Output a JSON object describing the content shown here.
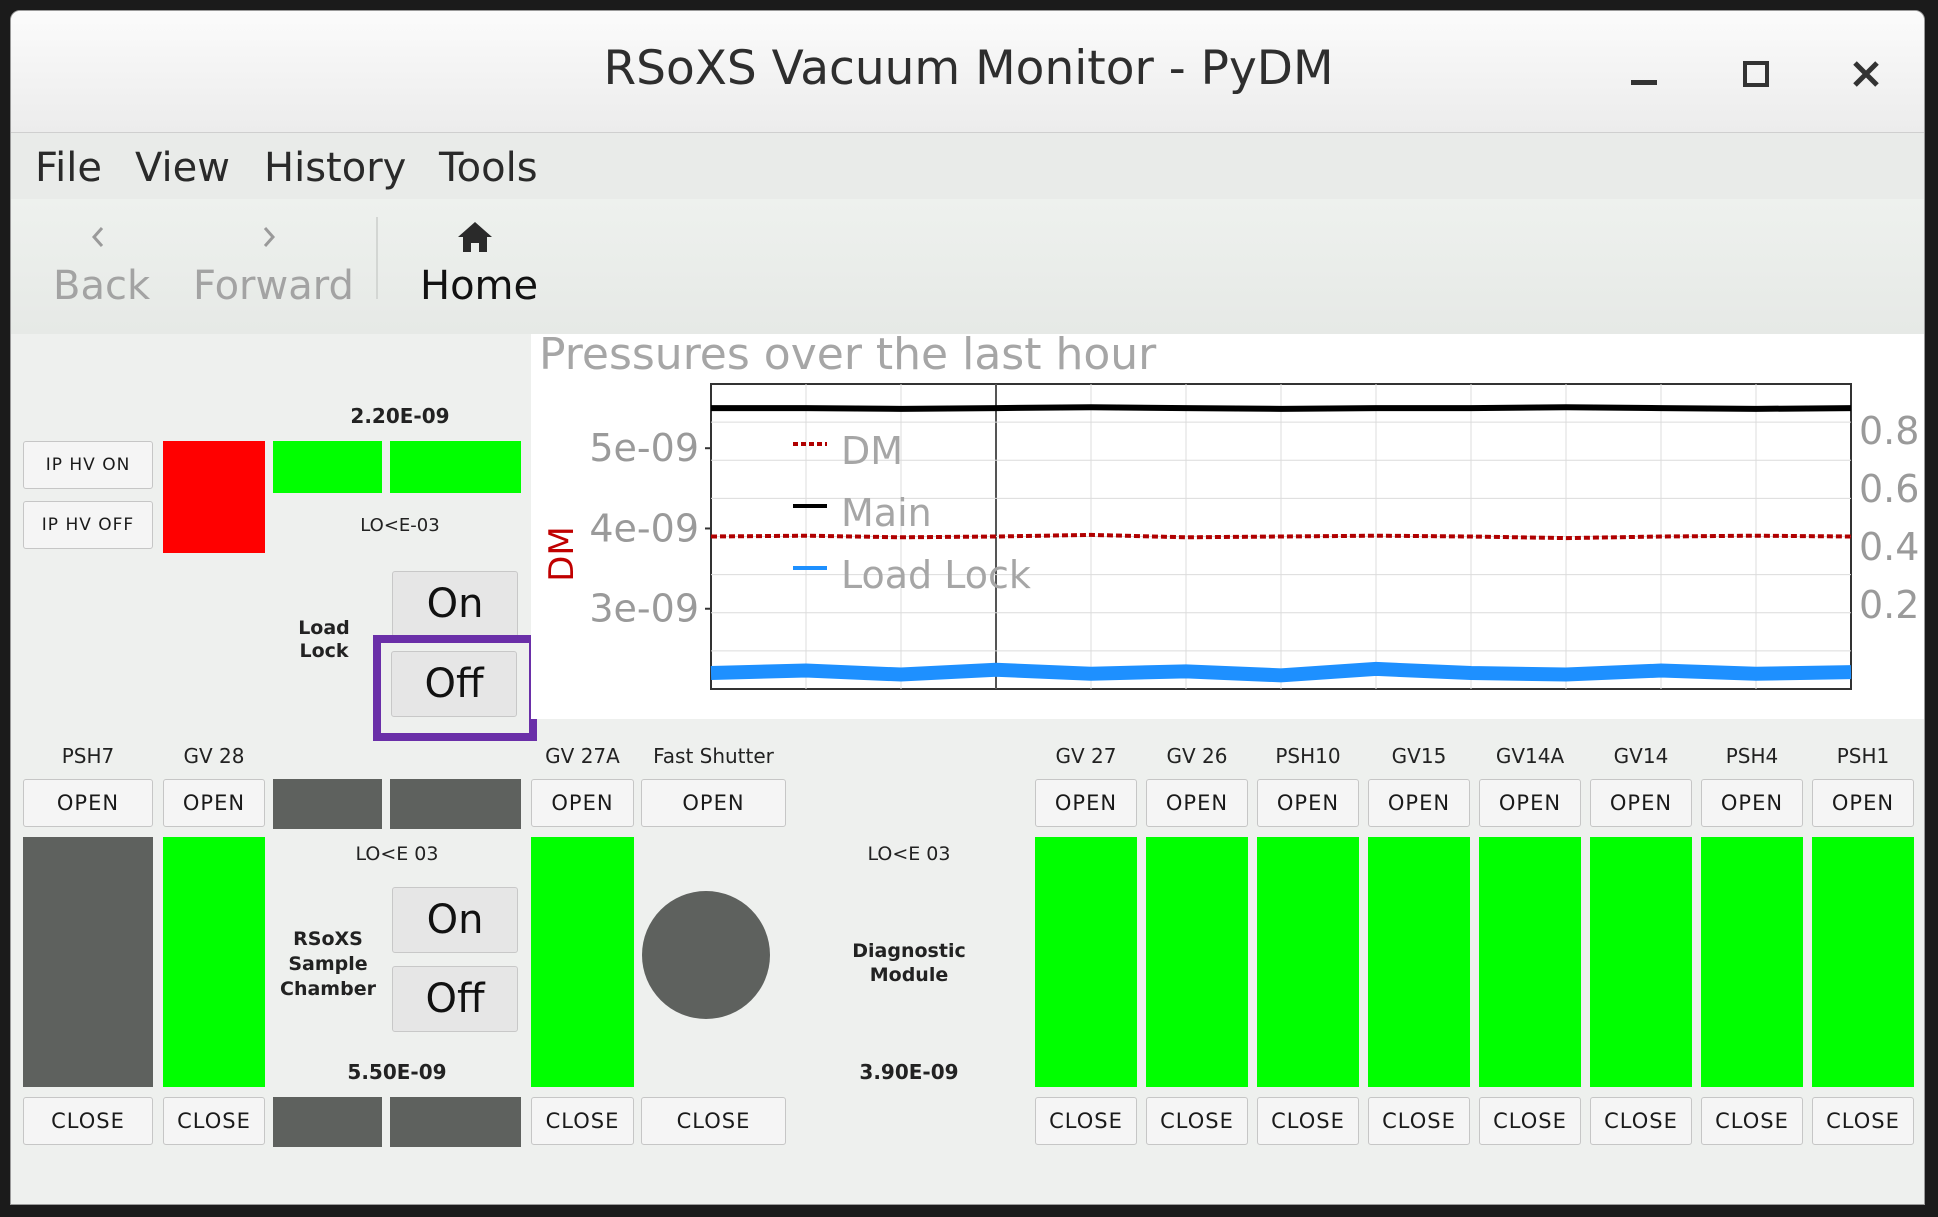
{
  "window": {
    "title": "RSoXS Vacuum Monitor - PyDM",
    "minimize_icon": "minimize-icon",
    "maximize_icon": "maximize-icon",
    "close_icon": "close-icon"
  },
  "menu": [
    "File",
    "View",
    "History",
    "Tools"
  ],
  "toolbar": {
    "back": "Back",
    "forward": "Forward",
    "home": "Home",
    "home_icon": "home-icon"
  },
  "loadlock": {
    "pressure": "2.20E-09",
    "range": "LO<E-03",
    "ip_hv_on": "IP HV ON",
    "ip_hv_off": "IP HV OFF",
    "label": "Load\nLock",
    "on": "On",
    "off": "Off"
  },
  "chamber": {
    "label": "RSoXS\nSample\nChamber",
    "range": "LO<E 03",
    "pressure": "5.50E-09",
    "on": "On",
    "off": "Off"
  },
  "diagnostic": {
    "label": "Diagnostic\nModule",
    "range": "LO<E 03",
    "pressure": "3.90E-09"
  },
  "buttons": {
    "open": "OPEN",
    "close": "CLOSE"
  },
  "valves_left": [
    {
      "name": "PSH7",
      "state": "closed"
    },
    {
      "name": "GV 28",
      "state": "open"
    }
  ],
  "valves_mid": [
    {
      "name": "GV 27A",
      "state": "open"
    },
    {
      "name": "Fast Shutter",
      "state": "closed"
    }
  ],
  "valves_right": [
    {
      "name": "GV 27",
      "state": "open"
    },
    {
      "name": "GV 26",
      "state": "open"
    },
    {
      "name": "PSH10",
      "state": "open"
    },
    {
      "name": "GV15",
      "state": "open"
    },
    {
      "name": "GV14A",
      "state": "open"
    },
    {
      "name": "GV14",
      "state": "open"
    },
    {
      "name": "PSH4",
      "state": "open"
    },
    {
      "name": "PSH1",
      "state": "open"
    }
  ],
  "colors": {
    "open": "#00ff00",
    "closed": "#5e615e",
    "alarm": "#ff0000",
    "dm": "#b00000",
    "main": "#000000",
    "loadlock": "#1e90ff",
    "highlight": "#6a2fa8"
  },
  "chart_data": {
    "type": "line",
    "title": "Pressures over the last hour",
    "ylabel": "DM",
    "ylim": [
      2e-09,
      5.8e-09
    ],
    "y_ticks": [
      "5e-09",
      "4e-09",
      "3e-09"
    ],
    "y2_ticks": [
      "0.8",
      "0.6",
      "0.4",
      "0.2"
    ],
    "legend": "top-left",
    "grid": true,
    "series": [
      {
        "name": "DM",
        "color": "#b00000",
        "style": "dotted",
        "values": [
          3.9e-09,
          3.91e-09,
          3.89e-09,
          3.9e-09,
          3.92e-09,
          3.89e-09,
          3.9e-09,
          3.91e-09,
          3.9e-09,
          3.88e-09,
          3.9e-09,
          3.91e-09,
          3.9e-09
        ]
      },
      {
        "name": "Main",
        "color": "#000000",
        "style": "solid",
        "values": [
          5.5e-09,
          5.5e-09,
          5.49e-09,
          5.5e-09,
          5.51e-09,
          5.5e-09,
          5.49e-09,
          5.5e-09,
          5.5e-09,
          5.51e-09,
          5.5e-09,
          5.49e-09,
          5.5e-09
        ]
      },
      {
        "name": "Load Lock",
        "color": "#1e90ff",
        "style": "solid",
        "values": [
          2.2e-09,
          2.23e-09,
          2.18e-09,
          2.24e-09,
          2.19e-09,
          2.22e-09,
          2.17e-09,
          2.25e-09,
          2.2e-09,
          2.18e-09,
          2.23e-09,
          2.19e-09,
          2.21e-09
        ]
      }
    ]
  }
}
